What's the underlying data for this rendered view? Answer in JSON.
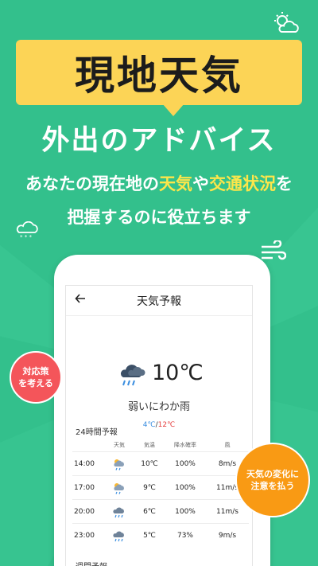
{
  "promo": {
    "title": "現地天気",
    "subtitle": "外出のアドバイス",
    "line1_a": "あなたの現在地の",
    "line1_hl1": "天気",
    "line1_mid": "や",
    "line1_hl2": "交通状況",
    "line1_b": "を",
    "line2": "把握するのに役立ちます"
  },
  "badges": {
    "left_line1": "対応策",
    "left_line2": "を考える",
    "right_line1": "天気の変化に",
    "right_line2": "注意を払う"
  },
  "app": {
    "back_icon": "arrow-left-icon",
    "title": "天気予報",
    "current": {
      "icon": "cloud-rain-icon",
      "temp": "10℃",
      "condition": "弱いにわか雨",
      "low": "4℃",
      "sep": "/",
      "high": "12℃"
    },
    "hourly_title": "24時間予報",
    "hourly_headers": [
      "天気",
      "気温",
      "降水確率",
      "風"
    ],
    "hourly": [
      {
        "time": "14:00",
        "icon": "partly-cloudy-rain-icon",
        "temp": "10℃",
        "rain": "100%",
        "wind": "8m/s"
      },
      {
        "time": "17:00",
        "icon": "partly-cloudy-rain-icon",
        "temp": "9℃",
        "rain": "100%",
        "wind": "11m/s"
      },
      {
        "time": "20:00",
        "icon": "cloud-rain-icon",
        "temp": "6℃",
        "rain": "100%",
        "wind": "11m/s"
      },
      {
        "time": "23:00",
        "icon": "cloud-rain-icon",
        "temp": "5℃",
        "rain": "73%",
        "wind": "9m/s"
      }
    ],
    "weekly_title": "週間予報"
  },
  "colors": {
    "background": "#33c08c",
    "banner": "#fcd456",
    "highlight": "#fde64a",
    "badge_red": "#f4555a",
    "badge_orange": "#f99a14",
    "low_temp": "#3c8fe0",
    "high_temp": "#e53e3e"
  }
}
